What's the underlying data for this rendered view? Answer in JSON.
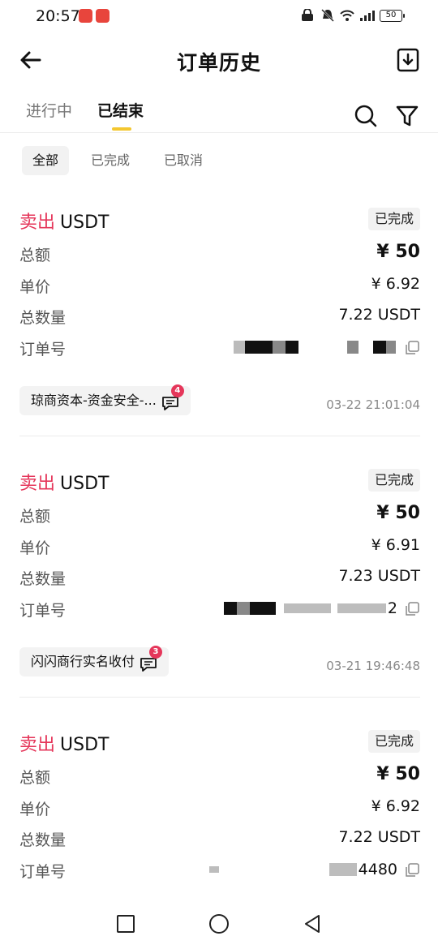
{
  "status_bar": {
    "time": "20:57",
    "battery": "50"
  },
  "header": {
    "title": "订单历史"
  },
  "tabs": [
    {
      "label": "进行中",
      "active": false
    },
    {
      "label": "已结束",
      "active": true
    }
  ],
  "filters": [
    {
      "label": "全部",
      "selected": true
    },
    {
      "label": "已完成",
      "selected": false
    },
    {
      "label": "已取消",
      "selected": false
    }
  ],
  "labels": {
    "total": "总额",
    "price": "单价",
    "quantity": "总数量",
    "order_no": "订单号"
  },
  "orders": [
    {
      "side": "卖出",
      "asset": "USDT",
      "status": "已完成",
      "total": "¥ 50",
      "price": "¥ 6.92",
      "quantity": "7.22 USDT",
      "order_no_visible": "",
      "merchant": "琼商资本-资金安全-...",
      "unread": "4",
      "time": "03-22 21:01:04"
    },
    {
      "side": "卖出",
      "asset": "USDT",
      "status": "已完成",
      "total": "¥ 50",
      "price": "¥ 6.91",
      "quantity": "7.23 USDT",
      "order_no_visible": "2",
      "merchant": "闪闪商行实名收付",
      "unread": "3",
      "time": "03-21 19:46:48"
    },
    {
      "side": "卖出",
      "asset": "USDT",
      "status": "已完成",
      "total": "¥ 50",
      "price": "¥ 6.92",
      "quantity": "7.22 USDT",
      "order_no_visible": "4480",
      "merchant": "",
      "unread": "",
      "time": ""
    }
  ],
  "colors": {
    "sell": "#e5365a",
    "tab_indicator": "#f4c72f",
    "badge": "#e5365a"
  }
}
